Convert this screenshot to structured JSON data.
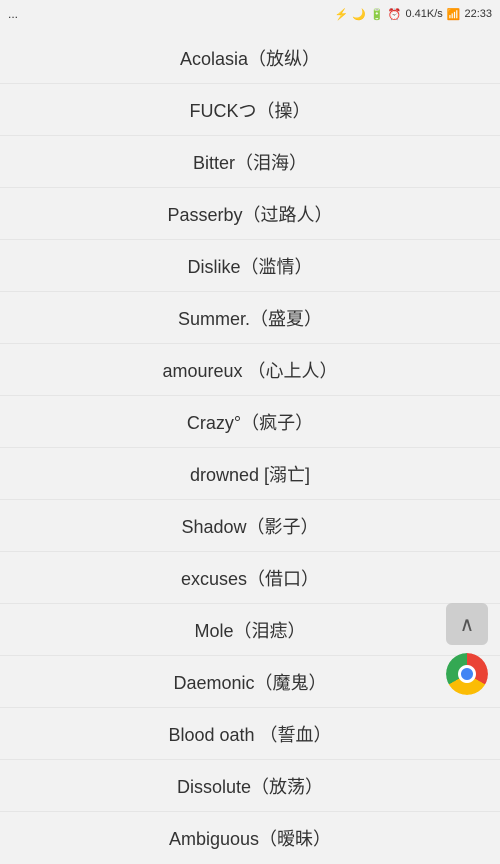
{
  "statusBar": {
    "left": "...",
    "bluetooth": "⚡",
    "time": "22:33",
    "network": "0.41K/s",
    "battery": "▓"
  },
  "items": [
    {
      "label": "Acolasia（放纵）"
    },
    {
      "label": "FUCKつ（操）"
    },
    {
      "label": "Bitter（泪海）"
    },
    {
      "label": "Passerby（过路人）"
    },
    {
      "label": "Dislike（滥情）"
    },
    {
      "label": "Summer.（盛夏）"
    },
    {
      "label": "amoureux （心上人）"
    },
    {
      "label": "Crazy°（疯子）"
    },
    {
      "label": "drowned [溺亡]"
    },
    {
      "label": "Shadow（影子）"
    },
    {
      "label": "excuses（借口）"
    },
    {
      "label": "Mole（泪痣）"
    },
    {
      "label": "Daemonic（魔鬼）"
    },
    {
      "label": "Blood oath （誓血）"
    },
    {
      "label": "Dissolute（放荡）"
    },
    {
      "label": "Ambiguous（暧昧）"
    }
  ],
  "scrollUpIcon": "∧",
  "buttons": {
    "scrollUp": "scroll-to-top"
  }
}
